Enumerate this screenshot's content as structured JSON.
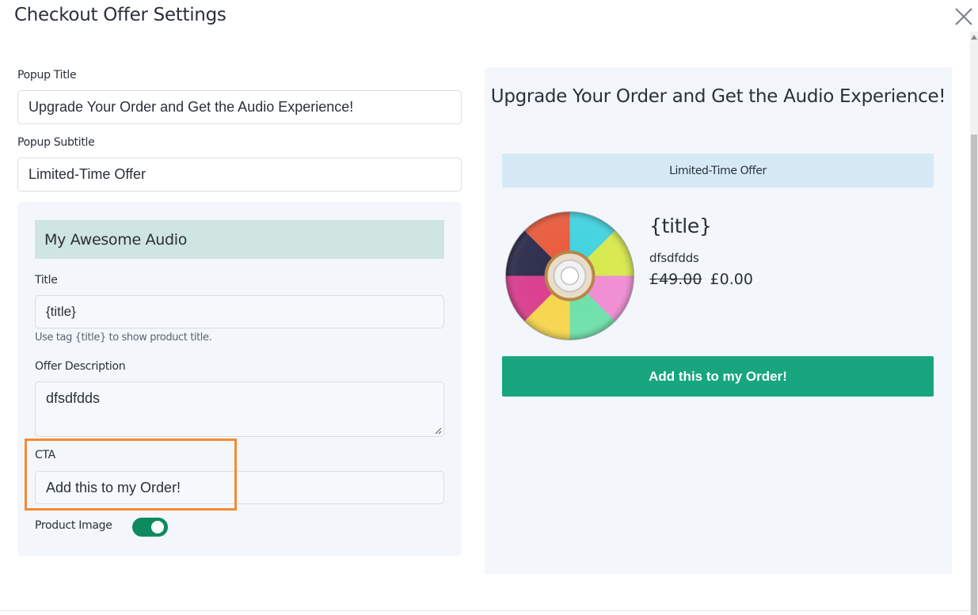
{
  "modal": {
    "title": "Checkout Offer Settings",
    "close_icon": "close-icon"
  },
  "form": {
    "popup_title_label": "Popup Title",
    "popup_title_value": "Upgrade Your Order and Get the Audio Experience!",
    "popup_subtitle_label": "Popup Subtitle",
    "popup_subtitle_value": "Limited-Time Offer",
    "product_card": {
      "name": "My Awesome Audio",
      "title_label": "Title",
      "title_value": "{title}",
      "title_hint": "Use tag {title} to show product title.",
      "offer_description_label": "Offer Description",
      "offer_description_value": "dfsdfdds",
      "cta_label": "CTA",
      "cta_value": "Add this to my Order!",
      "product_image_label": "Product Image",
      "product_image_enabled": true
    }
  },
  "preview": {
    "title": "Upgrade Your Order and Get the Audio Experience!",
    "subtitle": "Limited-Time Offer",
    "product_title": "{title}",
    "description": "dfsdfdds",
    "price_original": "£49.00",
    "price_offer": "£0.00",
    "cta": "Add this to my Order!",
    "image_icon": "cd-disc-icon"
  },
  "colors": {
    "accent_green": "#17a67e",
    "toggle_green": "#0f8a5f",
    "highlight_orange": "#f58a33",
    "card_header_bg": "#cfe5e2",
    "subtitle_bar_bg": "#d6eaf6",
    "panel_bg": "#f3f7fb"
  }
}
